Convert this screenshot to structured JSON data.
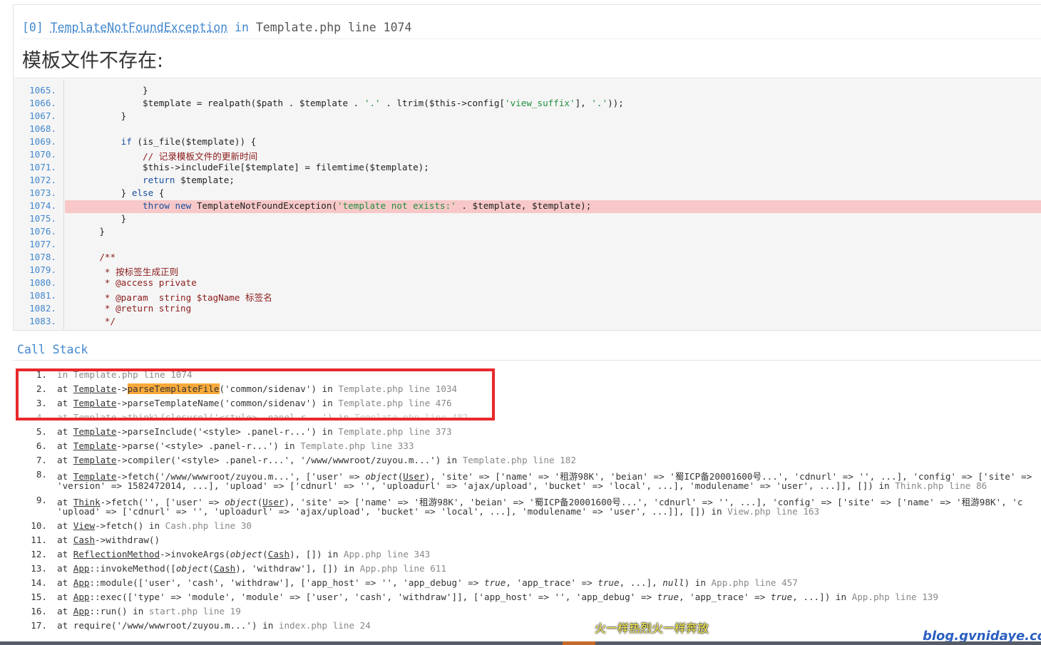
{
  "exception": {
    "index": "[0]",
    "class_name": "TemplateNotFoundException",
    "in_word": "in",
    "location": "Template.php line 1074",
    "message": "模板文件不存在:"
  },
  "code_lines": [
    {
      "no": "1065.",
      "code": "            }"
    },
    {
      "no": "1066.",
      "code": "            $template = realpath($path . $template . '.' . ltrim($this->config['view_suffix'], '.'));"
    },
    {
      "no": "1067.",
      "code": "        }"
    },
    {
      "no": "1068.",
      "code": ""
    },
    {
      "no": "1069.",
      "code": "        if (is_file($template)) {"
    },
    {
      "no": "1070.",
      "code": "            // 记录模板文件的更新时间"
    },
    {
      "no": "1071.",
      "code": "            $this->includeFile[$template] = filemtime($template);"
    },
    {
      "no": "1072.",
      "code": "            return $template;"
    },
    {
      "no": "1073.",
      "code": "        } else {"
    },
    {
      "no": "1074.",
      "code": "            throw new TemplateNotFoundException('template not exists:' . $template, $template);"
    },
    {
      "no": "1075.",
      "code": "        }"
    },
    {
      "no": "1076.",
      "code": "    }"
    },
    {
      "no": "1077.",
      "code": ""
    },
    {
      "no": "1078.",
      "code": "    /**"
    },
    {
      "no": "1079.",
      "code": "     * 按标签生成正则"
    },
    {
      "no": "1080.",
      "code": "     * @access private"
    },
    {
      "no": "1081.",
      "code": "     * @param  string $tagName 标签名"
    },
    {
      "no": "1082.",
      "code": "     * @return string"
    },
    {
      "no": "1083.",
      "code": "     */"
    }
  ],
  "highlighted_line": "1074.",
  "call_stack": {
    "title": "Call Stack",
    "frames": [
      {
        "no": "1.",
        "text": "in Template.php line 1074"
      },
      {
        "no": "2.",
        "text": "at Template->parseTemplateFile('common/sidenav') in Template.php line 1034"
      },
      {
        "no": "3.",
        "text": "at Template->parseTemplateName('common/sidenav') in Template.php line 476"
      },
      {
        "no": "4.",
        "text": "at Template->think\\{closure}('<style> .panel-r...') in Template.php line 482"
      },
      {
        "no": "5.",
        "text": "at Template->parseInclude('<style> .panel-r...') in Template.php line 373"
      },
      {
        "no": "6.",
        "text": "at Template->parse('<style> .panel-r...') in Template.php line 333"
      },
      {
        "no": "7.",
        "text": "at Template->compiler('<style> .panel-r...', '/www/wwwroot/zuyou.m...') in Template.php line 182"
      },
      {
        "no": "8.",
        "text": "at Template->fetch('/www/wwwroot/zuyou.m...', ['user' => object(User), 'site' => ['name' => '租游98K', 'beian' => '蜀ICP备20001600号...', 'cdnurl' => '', ...], 'config' => ['site' =>",
        "text2": "'version' => 1582472014, ...], 'upload' => ['cdnurl' => '', 'uploadurl' => 'ajax/upload', 'bucket' => 'local', ...], 'modulename' => 'user', ...]], []) in Think.php line 86"
      },
      {
        "no": "9.",
        "text": "at Think->fetch('', ['user' => object(User), 'site' => ['name' => '租游98K', 'beian' => '蜀ICP备20001600号...', 'cdnurl' => '', ...], 'config' => ['site' => ['name' => '租游98K', 'c",
        "text2": "'upload' => ['cdnurl' => '', 'uploadurl' => 'ajax/upload', 'bucket' => 'local', ...], 'modulename' => 'user', ...]], []) in View.php line 163"
      },
      {
        "no": "10.",
        "text": "at View->fetch() in Cash.php line 30"
      },
      {
        "no": "11.",
        "text": "at Cash->withdraw()"
      },
      {
        "no": "12.",
        "text": "at ReflectionMethod->invokeArgs(object(Cash), []) in App.php line 343"
      },
      {
        "no": "13.",
        "text": "at App::invokeMethod([object(Cash), 'withdraw'], []) in App.php line 611"
      },
      {
        "no": "14.",
        "text": "at App::module(['user', 'cash', 'withdraw'], ['app_host' => '', 'app_debug' => true, 'app_trace' => true, ...], null) in App.php line 457"
      },
      {
        "no": "15.",
        "text": "at App::exec(['type' => 'module', 'module' => ['user', 'cash', 'withdraw']], ['app_host' => '', 'app_debug' => true, 'app_trace' => true, ...]) in App.php line 139"
      },
      {
        "no": "16.",
        "text": "at App::run() in start.php line 19"
      },
      {
        "no": "17.",
        "text": "at require('/www/wwwroot/zuyou.m...') in index.php line 24"
      }
    ]
  },
  "watermarks": {
    "center": "火一样热烈火一样奔放",
    "corner": "blog.gvnidaye.com"
  },
  "colors": {
    "accent": "#4288ce",
    "highlight_row": "#f8c8c8",
    "annotation_box": "#e8282b",
    "method_highlight": "#f9a93b"
  }
}
